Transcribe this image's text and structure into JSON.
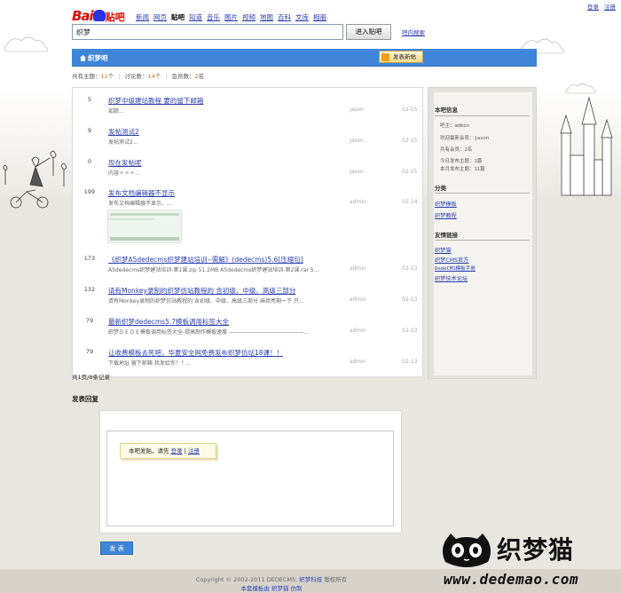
{
  "header": {
    "logo_text_bai": "Bai",
    "logo_text_du": "du",
    "logo_text_tieba": "贴吧",
    "nav": [
      "新闻",
      "网页",
      "贴吧",
      "知道",
      "音乐",
      "图片",
      "视频",
      "地图",
      "百科",
      "文库",
      "相册"
    ],
    "active_nav": "贴吧",
    "top_links": [
      "登录",
      "注册"
    ],
    "search_value": "织梦",
    "search_button": "进入贴吧",
    "inbar_search": "吧内搜索"
  },
  "bar": {
    "title": "织梦吧",
    "new_post": "发表新帖"
  },
  "stats": {
    "topics_label": "共有主题：",
    "topics_value": "11",
    "topics_unit": "个",
    "replies_label": "讨论数：",
    "replies_value": "14",
    "replies_unit": "个",
    "members_label": "会员数：",
    "members_value": "2",
    "members_unit": "名"
  },
  "threads": [
    {
      "count": "5",
      "title": "织梦中级建站教程 要的留下邮箱",
      "excerpt": "如题...",
      "author": "jason",
      "date": "02-15"
    },
    {
      "count": "9",
      "title": "发帖测试2",
      "excerpt": "发帖测试2...",
      "author": "jason",
      "date": "02-15"
    },
    {
      "count": "0",
      "title": "现在发帖呢",
      "excerpt": "内容＋＋＋...",
      "author": "jason",
      "date": "02-15"
    },
    {
      "count": "199",
      "title": "发布文档编辑器不显示",
      "excerpt": "发布文档编辑器不显示，...",
      "author": "admin",
      "date": "02-14"
    },
    {
      "count": "173",
      "title": "《织梦A5dedecms织梦建站培训--需解》(dedecms)5.6[压缩包]",
      "excerpt": "A5dedecms织梦建站培训-第1课.zip 51.2MB A5dedecms织梦建站培训-第2课.rar 5...",
      "author": "admin",
      "date": "02-13"
    },
    {
      "count": "132",
      "title": "请有Monkey录制的织梦仿站教程的 含初级、中级、高级三部分",
      "excerpt": "请有Monkey录制的织梦仿站教程的 含初级、中级、高级三部分 麻烦亮剩一下 只...",
      "author": "admin",
      "date": "02-13"
    },
    {
      "count": "79",
      "title": "最新织梦dedecms5.7模板调用标签大全",
      "excerpt": "织梦ＤＥＤＥ模板调用标签大全-提高制作模板速度 ——————————————...",
      "author": "admin",
      "date": "02-13"
    },
    {
      "count": "79",
      "title": "让收费模板去死吧，华夏安全网免费发布织梦仿站18课！！",
      "excerpt": "下载地址 留下邮箱 我发给你！！...",
      "author": "admin",
      "date": "02-13"
    }
  ],
  "page_info": "共1页/8条记录",
  "sidebar": {
    "info_heading": "本吧信息",
    "info_lines": [
      "吧主：admin",
      "欢迎最新会员：jason",
      "共有会员：2名",
      "今日发布主题：1篇",
      "本月发布主题：11篇"
    ],
    "category_heading": "分类",
    "categories": [
      "织梦模板",
      "织梦教程"
    ],
    "links_heading": "友情链接",
    "links": [
      "织梦猫",
      "织梦CMS官方",
      "DedeCMS模板手册",
      "织梦技术论坛"
    ]
  },
  "reply": {
    "label": "发表回复",
    "tip_prefix": "本吧发贴，请先",
    "tip_login": "登录",
    "tip_sep": "|",
    "tip_register": "注册",
    "submit": "发 表"
  },
  "footer": {
    "copyright": "Copyright © 2002-2011 DEDECMS.",
    "company": "织梦科技",
    "rights": "版权所有",
    "links": "本套模板由 织梦猫 仿制"
  },
  "watermark": {
    "title": "织梦猫",
    "url": "www.dedemao.com"
  },
  "colors": {
    "accent_blue": "#3f86d8",
    "link": "#2a3fb0",
    "orange": "#e06a00"
  }
}
